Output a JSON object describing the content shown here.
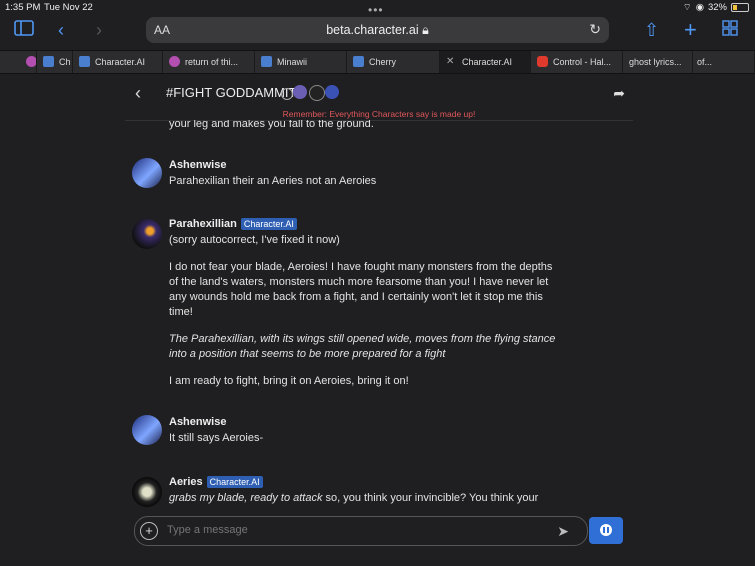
{
  "status": {
    "time": "1:35 PM",
    "date": "Tue Nov 22",
    "battery": "32%"
  },
  "browser": {
    "aa_label": "AA",
    "url": "beta.character.ai",
    "tabs": [
      {
        "label": "Ch",
        "color": "#4a7fd0"
      },
      {
        "label": "Character.AI",
        "color": "#4a7fd0"
      },
      {
        "label": "return of thi...",
        "color": "#b24fb0"
      },
      {
        "label": "Minawii",
        "color": "#4a7fd0"
      },
      {
        "label": "Cherry",
        "color": "#4a7fd0"
      },
      {
        "label": "Character.AI",
        "color": "#4a7fd0",
        "active": true
      },
      {
        "label": "Control - Hal...",
        "color": "#e03a2f"
      },
      {
        "label": "ghost lyrics...",
        "color": ""
      },
      {
        "label": "of...",
        "color": ""
      }
    ]
  },
  "chat": {
    "title": "#FIGHT GODDAMMIT",
    "remember": "Remember: Everything Characters say is made up!",
    "partial_text": "your leg and makes you fall to the ground.",
    "messages": [
      {
        "author": "Ashenwise",
        "badge": "",
        "paragraphs": [
          "Parahexilian their an Aeries not an Aeroies"
        ]
      },
      {
        "author": "Parahexillian",
        "badge": "Character.AI",
        "paragraphs": [
          "(sorry autocorrect, I've fixed it now)",
          "I do not fear your blade, Aeroies! I have fought many monsters from the depths of the land's waters, monsters much more fearsome than you! I have never let any wounds hold me back from a fight, and I certainly won't let it stop me this time!",
          "The Parahexillian, with its wings still opened wide, moves from the flying stance into a position that seems to be more prepared for a fight",
          "I am ready to fight, bring it on Aeroies, bring it on!"
        ]
      },
      {
        "author": "Ashenwise",
        "badge": "",
        "paragraphs": [
          "It still says Aeroies-"
        ]
      },
      {
        "author": "Aeries",
        "badge": "Character.AI",
        "paragraphs": [
          "grabs my blade, ready to attack so, you think your invincible? You think your"
        ],
        "italic_prefix": "grabs my blade, ready to attack",
        "rest": " so, you think your invincible? You think your"
      }
    ],
    "input_placeholder": "Type a message"
  }
}
